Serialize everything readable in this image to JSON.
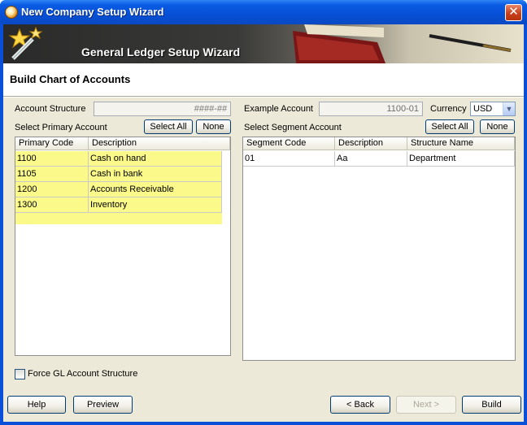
{
  "window": {
    "title": "New Company Setup Wizard"
  },
  "banner": {
    "title": "General Ledger Setup Wizard"
  },
  "page": {
    "title": "Build Chart of Accounts"
  },
  "left": {
    "account_structure_label": "Account Structure",
    "account_structure_value": "####-##",
    "select_primary_label": "Select Primary Account",
    "select_all_label": "Select All",
    "none_label": "None",
    "columns": [
      "Primary Code",
      "Description"
    ],
    "rows": [
      {
        "code": "1100",
        "description": "Cash on hand"
      },
      {
        "code": "1105",
        "description": "Cash in bank"
      },
      {
        "code": "1200",
        "description": "Accounts Receivable"
      },
      {
        "code": "1300",
        "description": "Inventory"
      }
    ],
    "highlight_color": "#fbf98a"
  },
  "right": {
    "example_account_label": "Example Account",
    "example_account_value": "1100-01",
    "currency_label": "Currency",
    "currency_value": "USD",
    "select_segment_label": "Select Segment Account",
    "select_all_label": "Select All",
    "none_label": "None",
    "columns": [
      "Segment Code",
      "Description",
      "Structure Name"
    ],
    "rows": [
      {
        "code": "01",
        "description": "Aa",
        "structure": "Department"
      }
    ]
  },
  "force_gl": {
    "label": "Force GL Account Structure",
    "checked": false
  },
  "footer": {
    "help": "Help",
    "preview": "Preview",
    "back": "< Back",
    "next": "Next >",
    "build": "Build"
  }
}
